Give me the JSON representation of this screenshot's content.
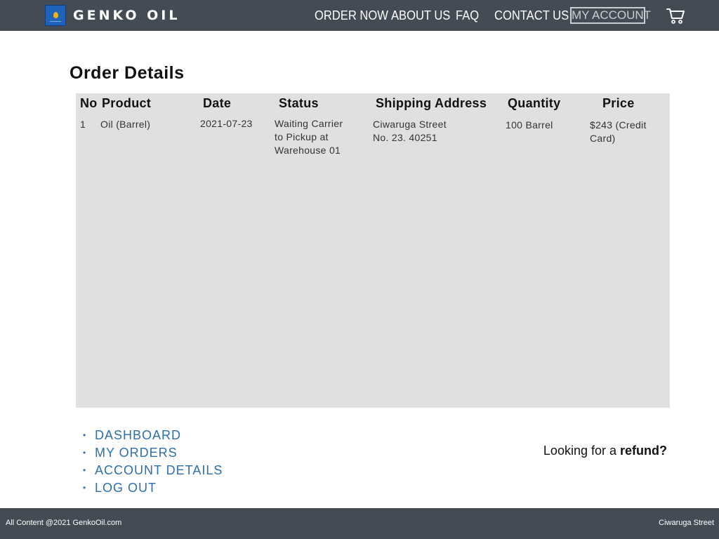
{
  "header": {
    "brand": "GENKO OIL",
    "nav": {
      "order_now": "ORDER NOW",
      "about_us": "ABOUT US",
      "faq": "FAQ",
      "contact_us": "CONTACT US",
      "my_account": "MY ACCOUNT"
    },
    "cart_icon": "shopping-cart-icon",
    "logo_icon": "oil-drop-icon"
  },
  "page": {
    "title": "Order Details"
  },
  "table": {
    "headers": {
      "no": "No",
      "product": "Product",
      "date": "Date",
      "status": "Status",
      "shipping_address": "Shipping Address",
      "quantity": "Quantity",
      "price": "Price"
    },
    "rows": [
      {
        "no": "1",
        "product": "Oil (Barrel)",
        "date": "2021-07-23",
        "status": "Waiting Carrier to Pickup at Warehouse 01",
        "shipping_address": "Ciwaruga Street No. 23. 40251",
        "quantity": "100 Barrel",
        "price": "$243 (Credit Card)"
      }
    ]
  },
  "account_nav": {
    "items": [
      {
        "label": "DASHBOARD"
      },
      {
        "label": "MY ORDERS"
      },
      {
        "label": "ACCOUNT DETAILS"
      },
      {
        "label": "LOG OUT"
      }
    ]
  },
  "refund": {
    "prefix": "Looking for a ",
    "link": "refund?"
  },
  "footer": {
    "left": "All Content @2021 GenkoOil.com",
    "right": "Ciwaruga Street"
  },
  "colors": {
    "header_bg": "#434c55",
    "table_bg": "#e0e0e0",
    "link_blue": "#2c6fb0",
    "logo_blue": "#1f63b8",
    "logo_drop": "#f2b01e"
  }
}
